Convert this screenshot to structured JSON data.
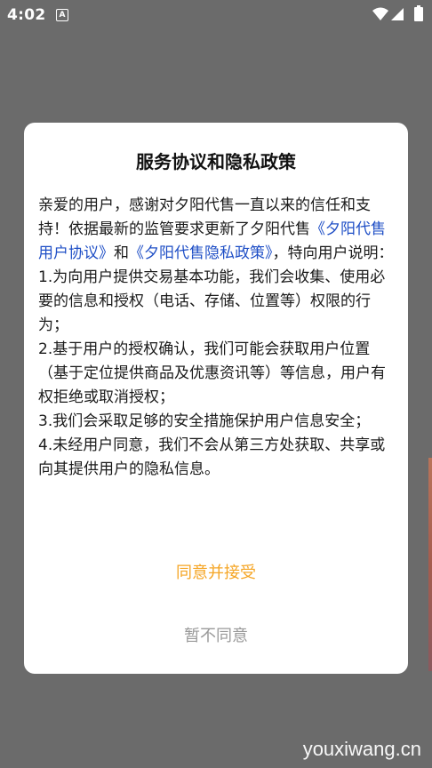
{
  "status_bar": {
    "time": "4:02",
    "notification_glyph": "A",
    "icons": [
      "wifi-icon",
      "signal-icon",
      "battery-icon"
    ]
  },
  "dialog": {
    "title": "服务协议和隐私政策",
    "intro_1": "亲爱的用户，感谢对夕阳代售一直以来的信任和支持！依据最新的监管要求更新了夕阳代售",
    "link_user_agreement": "《夕阳代售用户协议》",
    "and_text": "和",
    "link_privacy_policy": "《夕阳代售隐私政策》",
    "intro_2": "，特向用户说明：",
    "item_1": "1.为向用户提供交易基本功能，我们会收集、使用必要的信息和授权（电话、存储、位置等）权限的行为；",
    "item_2": "2.基于用户的授权确认，我们可能会获取用户位置（基于定位提供商品及优惠资讯等）等信息，用户有权拒绝或取消授权；",
    "item_3": "3.我们会采取足够的安全措施保护用户信息安全；",
    "item_4": "4.未经用户同意，我们不会从第三方处获取、共享或向其提供用户的隐私信息。",
    "agree_label": "同意并接受",
    "decline_label": "暂不同意"
  },
  "watermark": "youxiwang.cn",
  "colors": {
    "overlay": "#6b6b6b",
    "link": "#1f4fc6",
    "accent": "#f5a524",
    "muted": "#999999"
  }
}
